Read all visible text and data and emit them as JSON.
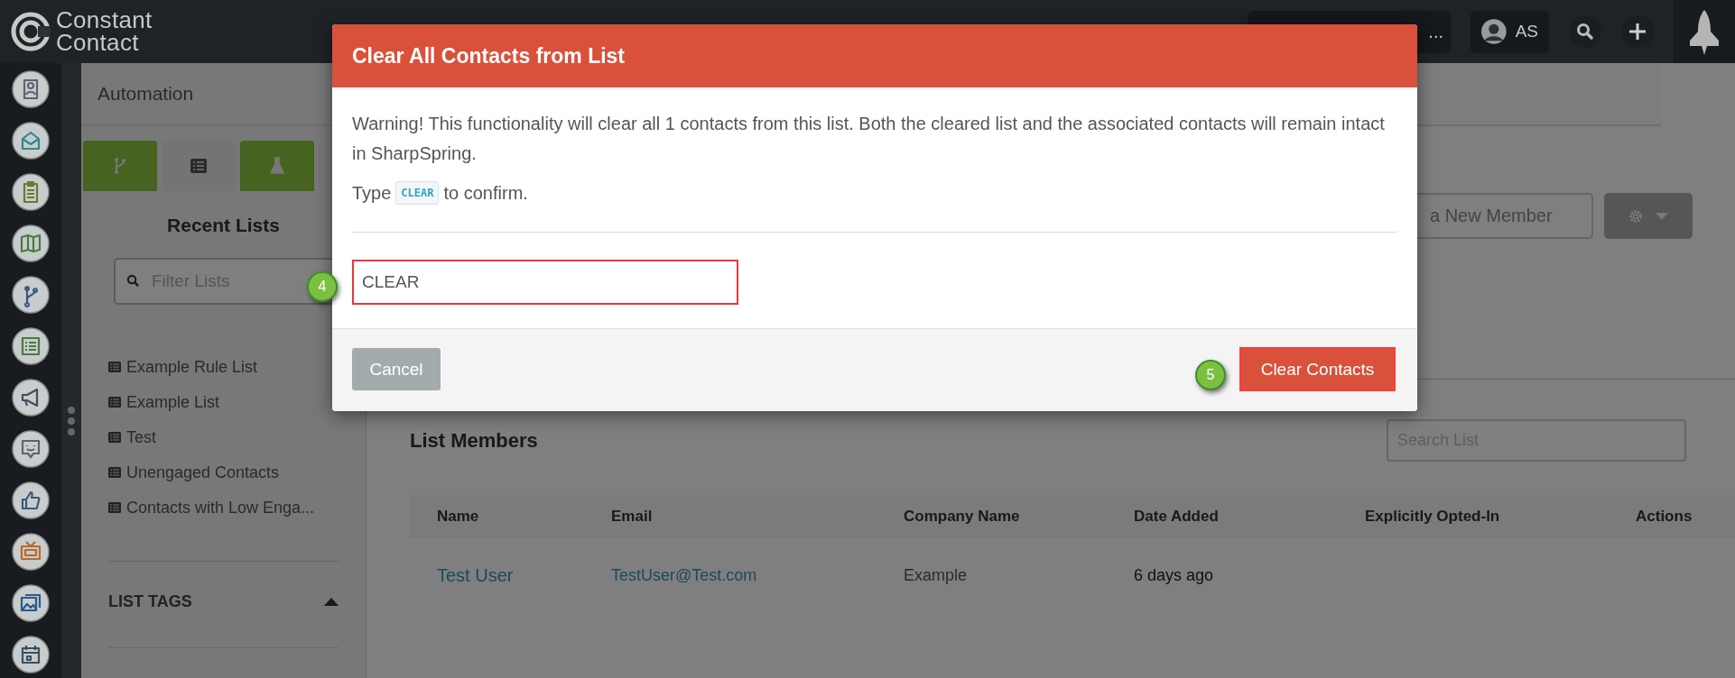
{
  "logo": {
    "line_1": "Constant",
    "line_2": "Contact"
  },
  "top_bar": {
    "cut_field_text": "...",
    "user_initials": "AS"
  },
  "left_panel": {
    "title": "Automation",
    "tabs": [
      {
        "selected": false
      },
      {
        "selected": true
      },
      {
        "selected": false
      }
    ],
    "recent_lists": {
      "heading": "Recent Lists",
      "filter_placeholder": "Filter Lists",
      "items": [
        {
          "label": "Example Rule List"
        },
        {
          "label": "Example List"
        },
        {
          "label": "Test"
        },
        {
          "label": "Unengaged Contacts"
        },
        {
          "label": "Contacts with Low Enga..."
        }
      ]
    },
    "list_tags": {
      "heading": "LIST TAGS",
      "expanded": true
    }
  },
  "main": {
    "member_field_placeholder": "a New Member",
    "list_members": {
      "title": "List Members",
      "search_placeholder": "Search List",
      "columns": [
        "Name",
        "Email",
        "Company Name",
        "Date Added",
        "Explicitly Opted-In",
        "Actions"
      ],
      "rows": [
        {
          "name": "Test User",
          "email": "TestUser@Test.com",
          "company": "Example",
          "date_added": "6 days ago"
        }
      ]
    }
  },
  "modal": {
    "title": "Clear All Contacts from List",
    "warning": "Warning! This functionality will clear all 1 contacts from this list. Both the cleared list and the associated contacts will remain intact in SharpSpring.",
    "confirm_prefix": "Type",
    "confirm_code": "CLEAR",
    "confirm_suffix": "to confirm.",
    "input_value": "CLEAR",
    "cancel_label": "Cancel",
    "submit_label": "Clear Contacts"
  },
  "callouts": [
    "4",
    "5"
  ]
}
